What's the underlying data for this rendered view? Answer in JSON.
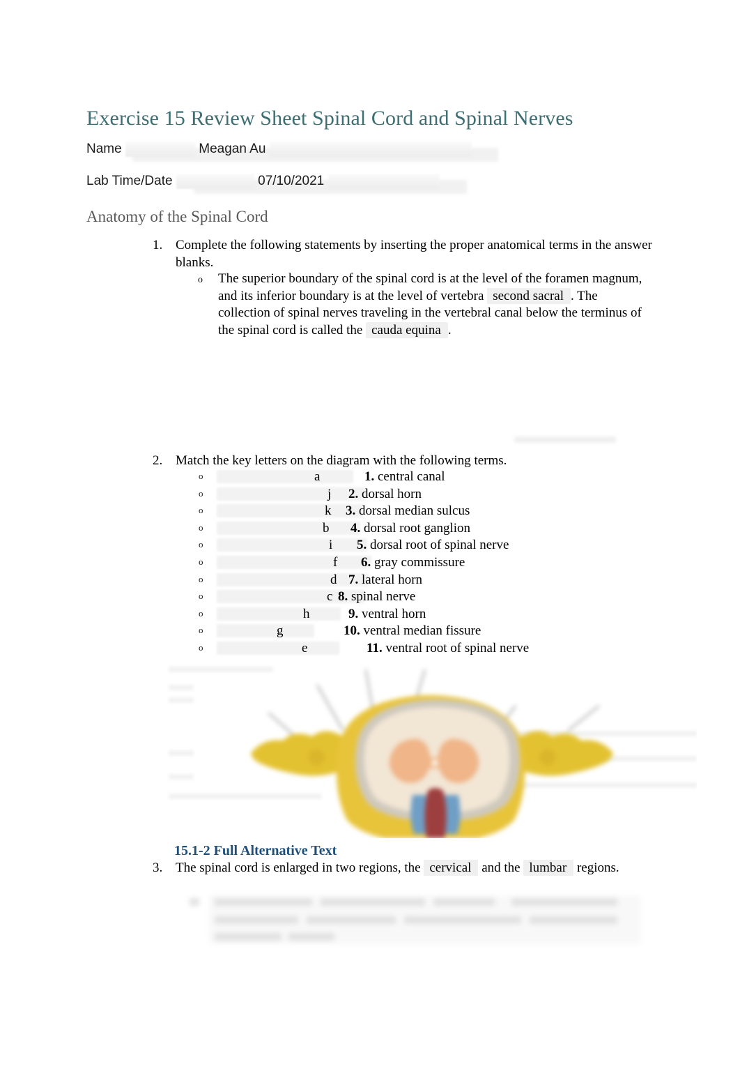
{
  "document": {
    "title": "Exercise 15 Review Sheet Spinal Cord and Spinal Nerves",
    "section_heading": "Anatomy of the Spinal Cord"
  },
  "fields": {
    "name_label": "Name",
    "name_value": "Meagan Au",
    "labtime_label": "Lab Time/Date",
    "labtime_value": "07/10/2021"
  },
  "questions": {
    "q1": {
      "number": "1.",
      "prompt": "Complete the following statements by inserting the proper anatomical terms in the answer blanks.",
      "sub_bullet_glyph": "o",
      "sub_text_1": "The superior boundary of the spinal cord is at the level of the foramen magnum, and its inferior boundary is at the level of vertebra ",
      "answer_1": "second sacral",
      "sub_text_2": ". The collection of spinal nerves traveling in the vertebral canal below the terminus of the spinal cord is called the ",
      "answer_2": "cauda equina",
      "sub_text_3": "."
    },
    "q2": {
      "number": "2.",
      "prompt": "Match the key letters on the diagram with the following terms."
    },
    "q3": {
      "number": "3.",
      "text_1": "The spinal cord is enlarged in two regions, the ",
      "answer_1": "cervical",
      "text_2": " and the ",
      "answer_2": "lumbar",
      "text_3": " regions."
    }
  },
  "match_items": [
    {
      "bullet": "o",
      "letter": "a",
      "num": "1.",
      "term": "central canal"
    },
    {
      "bullet": "o",
      "letter": "j",
      "num": "2.",
      "term": "dorsal horn"
    },
    {
      "bullet": "o",
      "letter": "k",
      "num": "3.",
      "term": "dorsal median sulcus"
    },
    {
      "bullet": "o",
      "letter": "b",
      "num": "4.",
      "term": "dorsal root ganglion"
    },
    {
      "bullet": "o",
      "letter": "i",
      "num": "5.",
      "term": "dorsal root of spinal nerve"
    },
    {
      "bullet": "o",
      "letter": "f",
      "num": "6.",
      "term": "gray commissure"
    },
    {
      "bullet": "o",
      "letter": "d",
      "num": "7.",
      "term": "lateral horn"
    },
    {
      "bullet": "o",
      "letter": "c",
      "num": "8.",
      "term": "spinal nerve"
    },
    {
      "bullet": "o",
      "letter": "h",
      "num": "9.",
      "term": "ventral horn"
    },
    {
      "bullet": "o",
      "letter": "g",
      "num": "10.",
      "term": "ventral median fissure"
    },
    {
      "bullet": "o",
      "letter": "e",
      "num": "11.",
      "term": "ventral root of spinal nerve"
    }
  ],
  "figure": {
    "caption_heading": "15.1-2 Full Alternative Text",
    "alt": "blurred cross-section illustration of the spinal cord within a vertebra with leader lines"
  },
  "colors": {
    "title": "#3d6e72",
    "section_heading": "#5a5a5a",
    "alt_heading": "#1f4e79",
    "answer_highlight": "#f0f0f0",
    "body_text": "#000000"
  }
}
